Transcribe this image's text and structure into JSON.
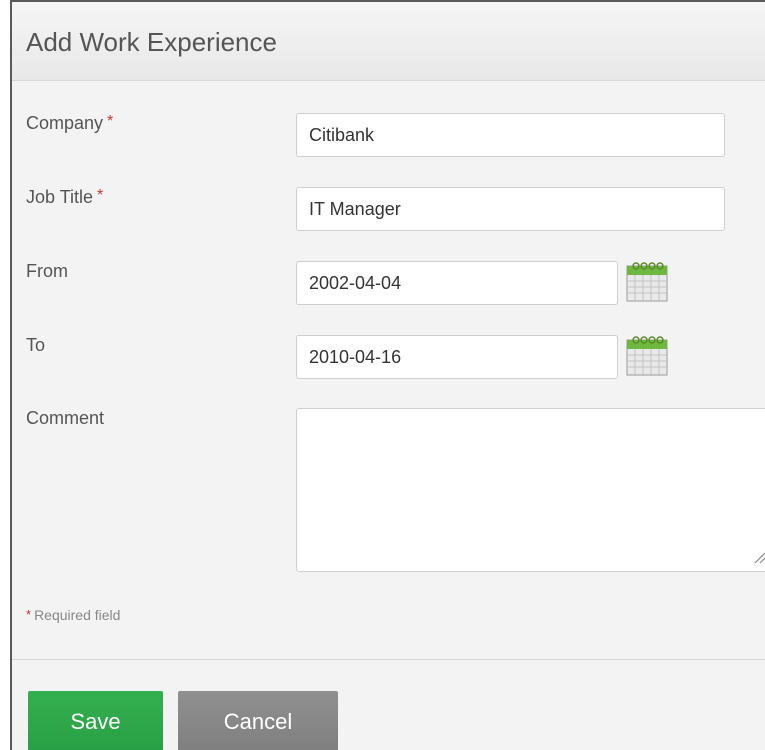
{
  "dialog": {
    "title": "Add Work Experience"
  },
  "form": {
    "company": {
      "label": "Company",
      "required_mark": "*",
      "value": "Citibank"
    },
    "job_title": {
      "label": "Job Title",
      "required_mark": "*",
      "value": "IT Manager"
    },
    "from": {
      "label": "From",
      "value": "2002-04-04",
      "icon": "calendar-icon"
    },
    "to": {
      "label": "To",
      "value": "2010-04-16",
      "icon": "calendar-icon"
    },
    "comment": {
      "label": "Comment",
      "value": ""
    },
    "required_note": {
      "mark": "*",
      "text": "Required field"
    }
  },
  "actions": {
    "save_label": "Save",
    "cancel_label": "Cancel"
  },
  "colors": {
    "required": "#c0392b",
    "save": "#2da44e",
    "cancel": "#888888",
    "panel_bg": "#f3f3f3"
  }
}
